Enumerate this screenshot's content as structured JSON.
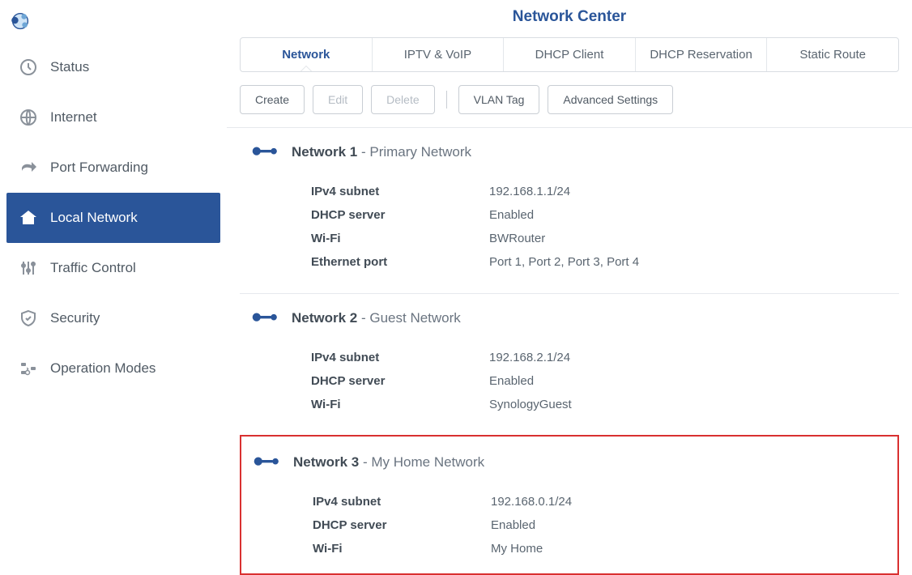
{
  "header": {
    "title": "Network Center"
  },
  "sidebar": {
    "items": [
      {
        "label": "Status"
      },
      {
        "label": "Internet"
      },
      {
        "label": "Port Forwarding"
      },
      {
        "label": "Local Network",
        "active": true
      },
      {
        "label": "Traffic Control"
      },
      {
        "label": "Security"
      },
      {
        "label": "Operation Modes"
      }
    ]
  },
  "tabs": [
    {
      "label": "Network",
      "active": true
    },
    {
      "label": "IPTV & VoIP"
    },
    {
      "label": "DHCP Client"
    },
    {
      "label": "DHCP Reservation"
    },
    {
      "label": "Static Route"
    }
  ],
  "toolbar": {
    "create": "Create",
    "edit": "Edit",
    "delete": "Delete",
    "vlan": "VLAN Tag",
    "advanced": "Advanced Settings"
  },
  "networks": [
    {
      "name": "Network 1",
      "desc": "Primary Network",
      "rows": [
        {
          "label": "IPv4 subnet",
          "value": "192.168.1.1/24"
        },
        {
          "label": "DHCP server",
          "value": "Enabled"
        },
        {
          "label": "Wi-Fi",
          "value": "BWRouter"
        },
        {
          "label": "Ethernet port",
          "value": "Port 1, Port 2, Port 3, Port 4"
        }
      ]
    },
    {
      "name": "Network 2",
      "desc": "Guest Network",
      "rows": [
        {
          "label": "IPv4 subnet",
          "value": "192.168.2.1/24"
        },
        {
          "label": "DHCP server",
          "value": "Enabled"
        },
        {
          "label": "Wi-Fi",
          "value": "SynologyGuest"
        }
      ]
    },
    {
      "name": "Network 3",
      "desc": "My Home Network",
      "highlight": true,
      "rows": [
        {
          "label": "IPv4 subnet",
          "value": "192.168.0.1/24"
        },
        {
          "label": "DHCP server",
          "value": "Enabled"
        },
        {
          "label": "Wi-Fi",
          "value": "My Home"
        }
      ]
    }
  ]
}
